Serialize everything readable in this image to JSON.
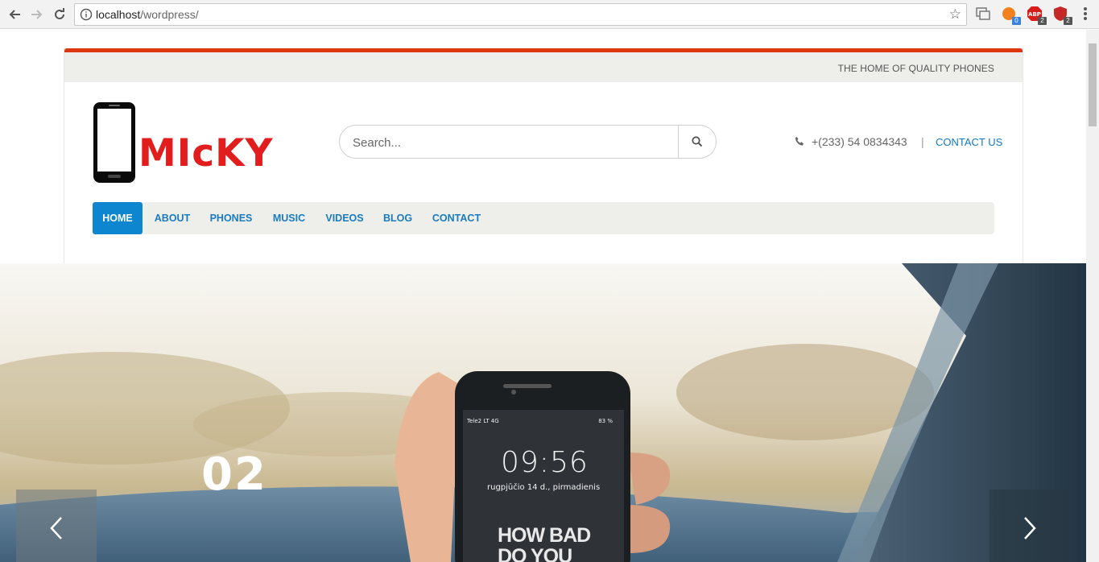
{
  "browser": {
    "url_host": "localhost",
    "url_path": "/wordpress/",
    "extensions": [
      {
        "name": "metamask-extension",
        "badge": "0",
        "badge_color": "#3b82e0"
      },
      {
        "name": "adblock-extension",
        "badge": "2",
        "badge_color": "#555555"
      },
      {
        "name": "ublock-extension",
        "badge": "2",
        "badge_color": "#555555"
      }
    ]
  },
  "site": {
    "tagline": "THE HOME OF QUALITY PHONES",
    "logo_text": "MIcKY",
    "search_placeholder": "Search...",
    "phone": "+(233) 54 0834343",
    "separator": "|",
    "contact_link": "CONTACT US",
    "accent_color": "#dc3711",
    "link_color": "#1279c1"
  },
  "menu": {
    "items": [
      {
        "label": "HOME",
        "active": true
      },
      {
        "label": "ABOUT",
        "active": false
      },
      {
        "label": "PHONES",
        "active": false
      },
      {
        "label": "MUSIC",
        "active": false
      },
      {
        "label": "VIDEOS",
        "active": false
      },
      {
        "label": "BLOG",
        "active": false
      },
      {
        "label": "CONTACT",
        "active": false
      }
    ]
  },
  "hero": {
    "slide_number": "02",
    "phone_screen": {
      "carrier": "Tele2 LT  4G",
      "battery": "83 %",
      "time": "09:56",
      "date": "rugpjūčio 14 d., pirmadienis",
      "caption_line1": "HOW BAD",
      "caption_line2": "DO YOU"
    }
  }
}
